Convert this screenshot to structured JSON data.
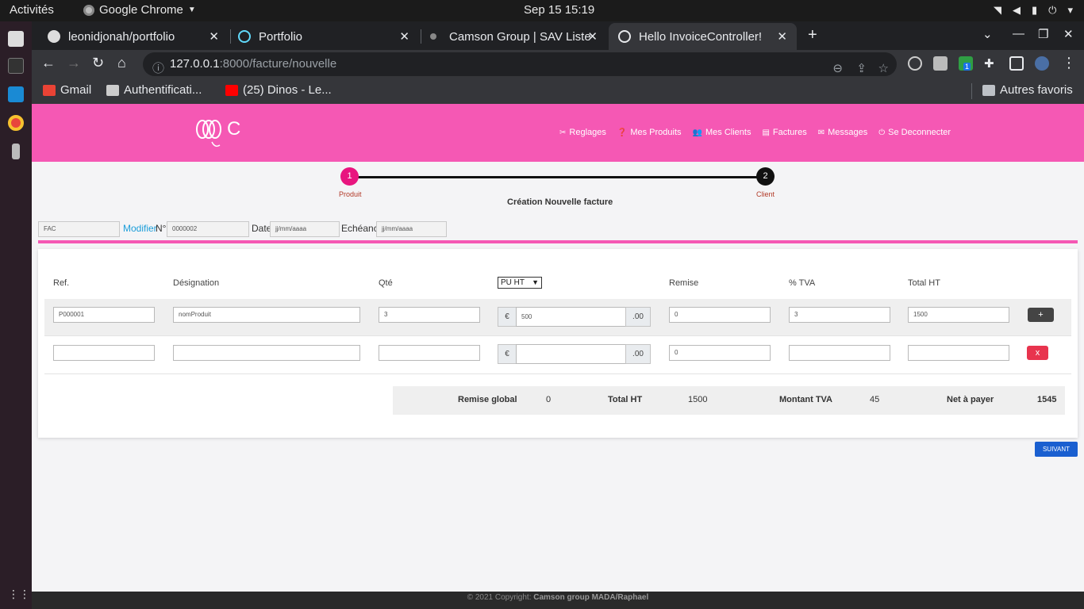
{
  "os": {
    "activities": "Activités",
    "app_name": "Google Chrome",
    "clock": "Sep 15  15:19"
  },
  "browser": {
    "tabs": [
      {
        "label": "leonidjonah/portfolio"
      },
      {
        "label": "Portfolio"
      },
      {
        "label": "Camson Group | SAV Liste"
      },
      {
        "label": "Hello InvoiceController!"
      }
    ],
    "url_host": "127.0.0.1",
    "url_path": ":8000/facture/nouvelle",
    "extension_badge": "1",
    "bookmarks": [
      {
        "label": "Gmail"
      },
      {
        "label": "Authentificati..."
      },
      {
        "label": "(25) Dinos - Le..."
      }
    ],
    "other_bookmarks": "Autres favoris"
  },
  "header": {
    "logo_letter": "C",
    "nav": [
      {
        "label": "Reglages",
        "icon": "tools-icon"
      },
      {
        "label": "Mes Produits",
        "icon": "question-circle-icon"
      },
      {
        "label": "Mes Clients",
        "icon": "users-icon"
      },
      {
        "label": "Factures",
        "icon": "file-icon"
      },
      {
        "label": "Messages",
        "icon": "envelope-icon"
      },
      {
        "label": "Se Deconnecter",
        "icon": "power-icon"
      }
    ]
  },
  "stepper": {
    "step1_num": "1",
    "step1_label": "Produit",
    "step2_num": "2",
    "step2_label": "Client"
  },
  "form": {
    "title": "Création Nouvelle facture",
    "prefix_value": "FAC",
    "modifier_link": "Modifier",
    "number_label": "N°",
    "number_value": "0000002",
    "date_label": "Date",
    "date_placeholder": "jj/mm/aaaa",
    "echeance_label": "Echéance",
    "echeance_placeholder": "jj/mm/aaaa"
  },
  "table": {
    "headers": {
      "ref": "Ref.",
      "designation": "Désignation",
      "qte": "Qté",
      "pu_select": "PU HT",
      "remise": "Remise",
      "tva": "% TVA",
      "total": "Total HT"
    },
    "currency": "€",
    "decimals": ".00",
    "rows": [
      {
        "ref": "P000001",
        "designation": "nomProduit",
        "qte": "3",
        "pu": "500",
        "remise": "0",
        "tva": "3",
        "total": "1500",
        "action": "+"
      },
      {
        "ref": "",
        "designation": "",
        "qte": "",
        "pu": "",
        "remise": "0",
        "tva": "",
        "total": "",
        "action": "x"
      }
    ]
  },
  "totals": {
    "remise_label": "Remise global",
    "remise_value": "0",
    "total_ht_label": "Total HT",
    "total_ht_value": "1500",
    "tva_label": "Montant TVA",
    "tva_value": "45",
    "net_label": "Net à payer",
    "net_value": "1545"
  },
  "actions": {
    "next_label": "SUIVANT"
  },
  "footer": {
    "prefix": "© 2021 Copyright:",
    "owner": "Camson group MADA/Raphael"
  },
  "colors": {
    "brand_pink": "#f558b4",
    "step_active": "#e8157f",
    "next_button": "#1a5fd0",
    "delete_button": "#e8344e"
  }
}
